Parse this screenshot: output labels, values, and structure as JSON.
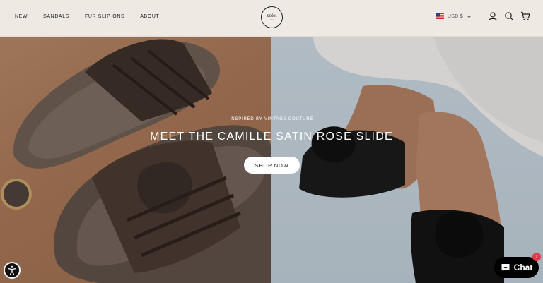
{
  "header": {
    "nav": [
      "NEW",
      "SANDALS",
      "FUR SLIP-ONS",
      "ABOUT"
    ],
    "logo": {
      "line1": "solei",
      "line2": "sea"
    },
    "currency": "USD $"
  },
  "hero": {
    "eyebrow": "INSPIRED BY VINTAGE COUTURE",
    "headline": "MEET THE CAMILLE SATIN ROSE SLIDE",
    "cta": "SHOP NOW"
  },
  "chat": {
    "label": "Chat",
    "badge": "1"
  },
  "icons": {
    "flag": "us-flag-icon",
    "currency_dropdown": "chevron-down-icon",
    "account": "account-icon",
    "search": "search-icon",
    "cart": "cart-icon",
    "accessibility": "accessibility-icon",
    "chat": "chat-bubble-icon"
  },
  "colors": {
    "header_bg": "#efe9e4",
    "chat_bg": "#000000",
    "badge_bg": "#e33a4b",
    "cta_bg": "#ffffff"
  }
}
